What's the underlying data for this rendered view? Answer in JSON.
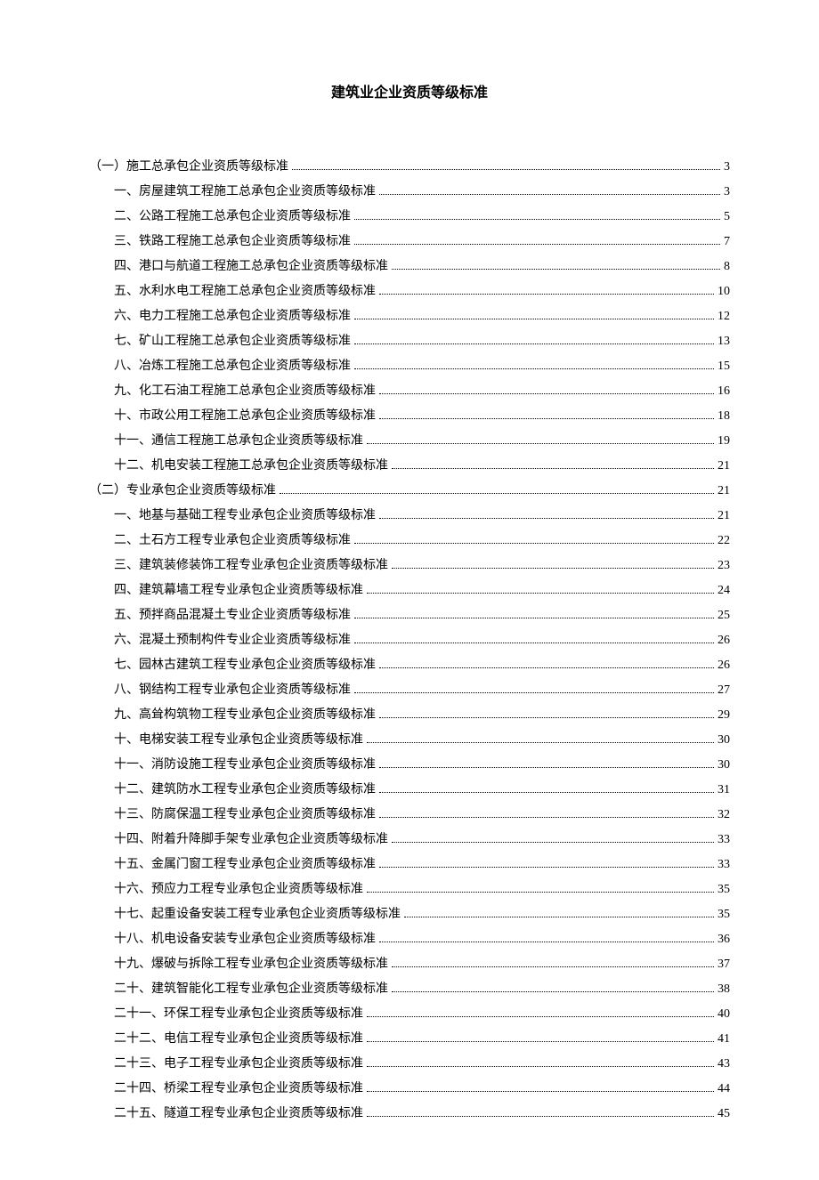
{
  "title": "建筑业企业资质等级标准",
  "toc": [
    {
      "level": 1,
      "label": "（一）施工总承包企业资质等级标准",
      "page": "3"
    },
    {
      "level": 2,
      "label": "一、房屋建筑工程施工总承包企业资质等级标准",
      "page": "3"
    },
    {
      "level": 2,
      "label": "二、公路工程施工总承包企业资质等级标准",
      "page": "5"
    },
    {
      "level": 2,
      "label": "三、铁路工程施工总承包企业资质等级标准",
      "page": "7"
    },
    {
      "level": 2,
      "label": "四、港口与航道工程施工总承包企业资质等级标准",
      "page": "8"
    },
    {
      "level": 2,
      "label": "五、水利水电工程施工总承包企业资质等级标准",
      "page": "10"
    },
    {
      "level": 2,
      "label": "六、电力工程施工总承包企业资质等级标准",
      "page": "12"
    },
    {
      "level": 2,
      "label": "七、矿山工程施工总承包企业资质等级标准",
      "page": "13"
    },
    {
      "level": 2,
      "label": "八、冶炼工程施工总承包企业资质等级标准",
      "page": "15"
    },
    {
      "level": 2,
      "label": "九、化工石油工程施工总承包企业资质等级标准",
      "page": "16"
    },
    {
      "level": 2,
      "label": "十、市政公用工程施工总承包企业资质等级标准",
      "page": "18"
    },
    {
      "level": 2,
      "label": "十一、通信工程施工总承包企业资质等级标准",
      "page": "19"
    },
    {
      "level": 2,
      "label": "十二、机电安装工程施工总承包企业资质等级标准",
      "page": "21"
    },
    {
      "level": 1,
      "label": "（二）专业承包企业资质等级标准",
      "page": "21"
    },
    {
      "level": 2,
      "label": "一、地基与基础工程专业承包企业资质等级标准",
      "page": "21"
    },
    {
      "level": 2,
      "label": "二、土石方工程专业承包企业资质等级标准",
      "page": "22"
    },
    {
      "level": 2,
      "label": "三、建筑装修装饰工程专业承包企业资质等级标准",
      "page": "23"
    },
    {
      "level": 2,
      "label": "四、建筑幕墙工程专业承包企业资质等级标准",
      "page": "24"
    },
    {
      "level": 2,
      "label": "五、预拌商品混凝土专业企业资质等级标准",
      "page": "25"
    },
    {
      "level": 2,
      "label": "六、混凝土预制构件专业企业资质等级标准",
      "page": "26"
    },
    {
      "level": 2,
      "label": "七、园林古建筑工程专业承包企业资质等级标准",
      "page": "26"
    },
    {
      "level": 2,
      "label": "八、钢结构工程专业承包企业资质等级标准",
      "page": "27"
    },
    {
      "level": 2,
      "label": "九、高耸构筑物工程专业承包企业资质等级标准",
      "page": "29"
    },
    {
      "level": 2,
      "label": "十、电梯安装工程专业承包企业资质等级标准",
      "page": "30"
    },
    {
      "level": 2,
      "label": "十一、消防设施工程专业承包企业资质等级标准",
      "page": "30"
    },
    {
      "level": 2,
      "label": "十二、建筑防水工程专业承包企业资质等级标准",
      "page": "31"
    },
    {
      "level": 2,
      "label": "十三、防腐保温工程专业承包企业资质等级标准",
      "page": "32"
    },
    {
      "level": 2,
      "label": "十四、附着升降脚手架专业承包企业资质等级标准",
      "page": "33"
    },
    {
      "level": 2,
      "label": "十五、金属门窗工程专业承包企业资质等级标准",
      "page": "33"
    },
    {
      "level": 2,
      "label": "十六、预应力工程专业承包企业资质等级标准",
      "page": "35"
    },
    {
      "level": 2,
      "label": "十七、起重设备安装工程专业承包企业资质等级标准",
      "page": "35"
    },
    {
      "level": 2,
      "label": "十八、机电设备安装专业承包企业资质等级标准",
      "page": "36"
    },
    {
      "level": 2,
      "label": "十九、爆破与拆除工程专业承包企业资质等级标准",
      "page": "37"
    },
    {
      "level": 2,
      "label": "二十、建筑智能化工程专业承包企业资质等级标准",
      "page": "38"
    },
    {
      "level": 2,
      "label": "二十一、环保工程专业承包企业资质等级标准",
      "page": "40"
    },
    {
      "level": 2,
      "label": "二十二、电信工程专业承包企业资质等级标准",
      "page": "41"
    },
    {
      "level": 2,
      "label": "二十三、电子工程专业承包企业资质等级标准",
      "page": "43"
    },
    {
      "level": 2,
      "label": "二十四、桥梁工程专业承包企业资质等级标准",
      "page": "44"
    },
    {
      "level": 2,
      "label": "二十五、隧道工程专业承包企业资质等级标准",
      "page": "45"
    }
  ]
}
